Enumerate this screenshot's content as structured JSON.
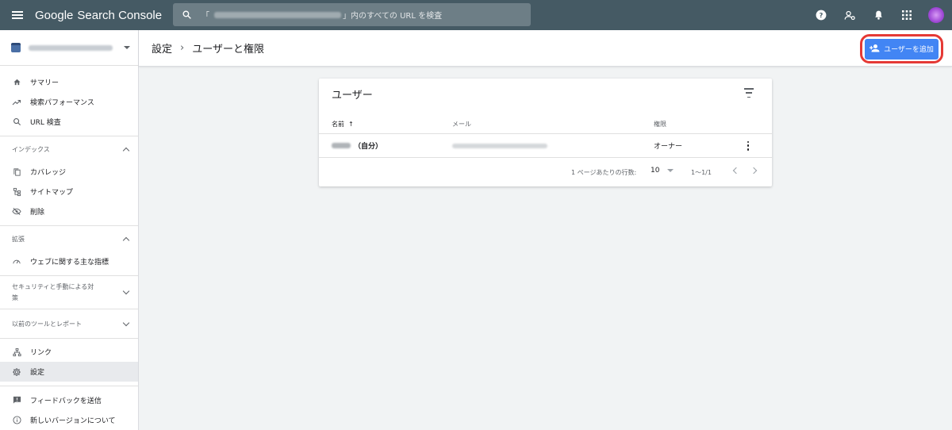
{
  "app": {
    "brand_google": "Google",
    "brand_product": "Search Console"
  },
  "search": {
    "placeholder_suffix": "」内のすべての URL を検査",
    "placeholder_prefix": "「"
  },
  "topbar_icons": [
    "help-icon",
    "account-settings-icon",
    "notifications-icon",
    "apps-grid-icon",
    "avatar"
  ],
  "sidebar": {
    "items_top": [
      {
        "label": "サマリー",
        "icon": "home-icon"
      },
      {
        "label": "検索パフォーマンス",
        "icon": "trending-up-icon"
      },
      {
        "label": "URL 検査",
        "icon": "search-icon"
      }
    ],
    "index_section": {
      "title": "インデックス",
      "items": [
        {
          "label": "カバレッジ",
          "icon": "copy-icon"
        },
        {
          "label": "サイトマップ",
          "icon": "sitemap-icon"
        },
        {
          "label": "削除",
          "icon": "visibility-off-icon"
        }
      ]
    },
    "enhance_section": {
      "title": "拡張",
      "items": [
        {
          "label": "ウェブに関する主な指標",
          "icon": "speed-icon"
        }
      ]
    },
    "security_section": {
      "title_line1": "セキュリティと手動による対",
      "title_line2": "策"
    },
    "legacy_section": {
      "title": "以前のツールとレポート"
    },
    "items_bottom": [
      {
        "label": "リンク",
        "icon": "links-icon"
      },
      {
        "label": "設定",
        "icon": "settings-icon"
      }
    ],
    "items_footer": [
      {
        "label": "フィードバックを送信",
        "icon": "feedback-icon"
      },
      {
        "label": "新しいバージョンについて",
        "icon": "info-icon"
      }
    ]
  },
  "header": {
    "crumb_parent": "設定",
    "separator": "›",
    "crumb_current": "ユーザーと権限",
    "add_user_label": "ユーザーを追加"
  },
  "users_card": {
    "title": "ユーザー",
    "columns": {
      "name": "名前",
      "sort_arrow": "↑",
      "email": "メール",
      "role": "権限"
    },
    "rows": [
      {
        "name_suffix": "（自分）",
        "role": "オーナー"
      }
    ],
    "pager": {
      "rows_per_page_label": "1 ページあたりの行数:",
      "rows_per_page": "10",
      "range": "1〜1/1"
    }
  },
  "colors": {
    "topbar": "#455a64",
    "primary_button": "#4285f4",
    "highlight_ring": "#e53935"
  }
}
